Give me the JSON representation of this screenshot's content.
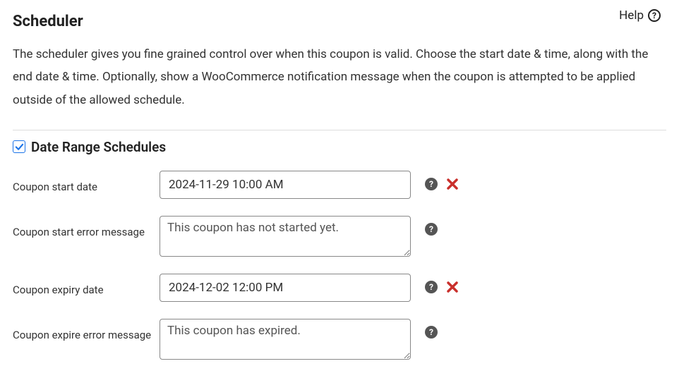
{
  "help": {
    "label": "Help"
  },
  "header": {
    "title": "Scheduler",
    "description": "The scheduler gives you fine grained control over when this coupon is valid. Choose the start date & time, along with the end date & time. Optionally, show a WooCommerce notification message when the coupon is attempted to be applied outside of the allowed schedule."
  },
  "section": {
    "checked": true,
    "title": "Date Range Schedules"
  },
  "fields": {
    "start_date": {
      "label": "Coupon start date",
      "value": "2024-11-29 10:00 AM"
    },
    "start_error": {
      "label": "Coupon start error message",
      "value": "This coupon has not started yet."
    },
    "expiry_date": {
      "label": "Coupon expiry date",
      "value": "2024-12-02 12:00 PM"
    },
    "expire_error": {
      "label": "Coupon expire error message",
      "value": "This coupon has expired."
    }
  }
}
